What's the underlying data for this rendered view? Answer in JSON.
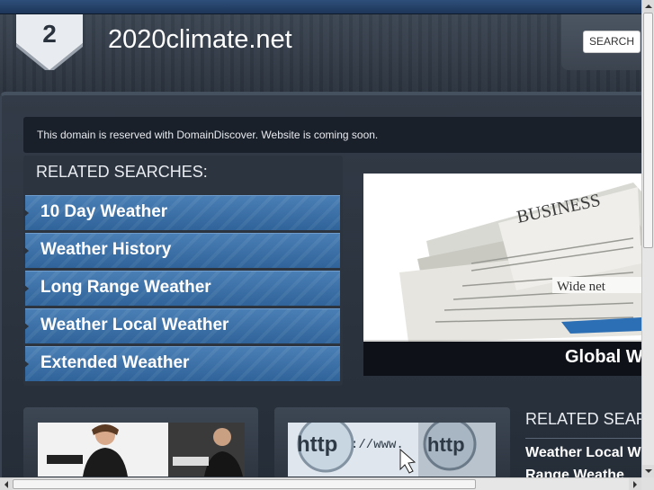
{
  "header": {
    "badge_number": "2",
    "site_title": "2020climate.net",
    "search_label": "SEARCH"
  },
  "notice": {
    "text": "This domain is reserved with DomainDiscover. Website is coming soon."
  },
  "related_searches": {
    "title": "RELATED SEARCHES:",
    "items": [
      {
        "label": "10 Day Weather"
      },
      {
        "label": "Weather History"
      },
      {
        "label": "Long Range Weather"
      },
      {
        "label": "Weather Local Weather"
      },
      {
        "label": "Extended Weather"
      }
    ]
  },
  "hero": {
    "caption": "Global W"
  },
  "related_searches_2": {
    "title": "RELATED SEAR",
    "links": [
      {
        "label": "Weather Local W"
      },
      {
        "label": "Range Weathe"
      }
    ]
  },
  "colors": {
    "accent_blue": "#3a70a8",
    "background": "#1c2430",
    "notice_bg": "#19202a"
  }
}
